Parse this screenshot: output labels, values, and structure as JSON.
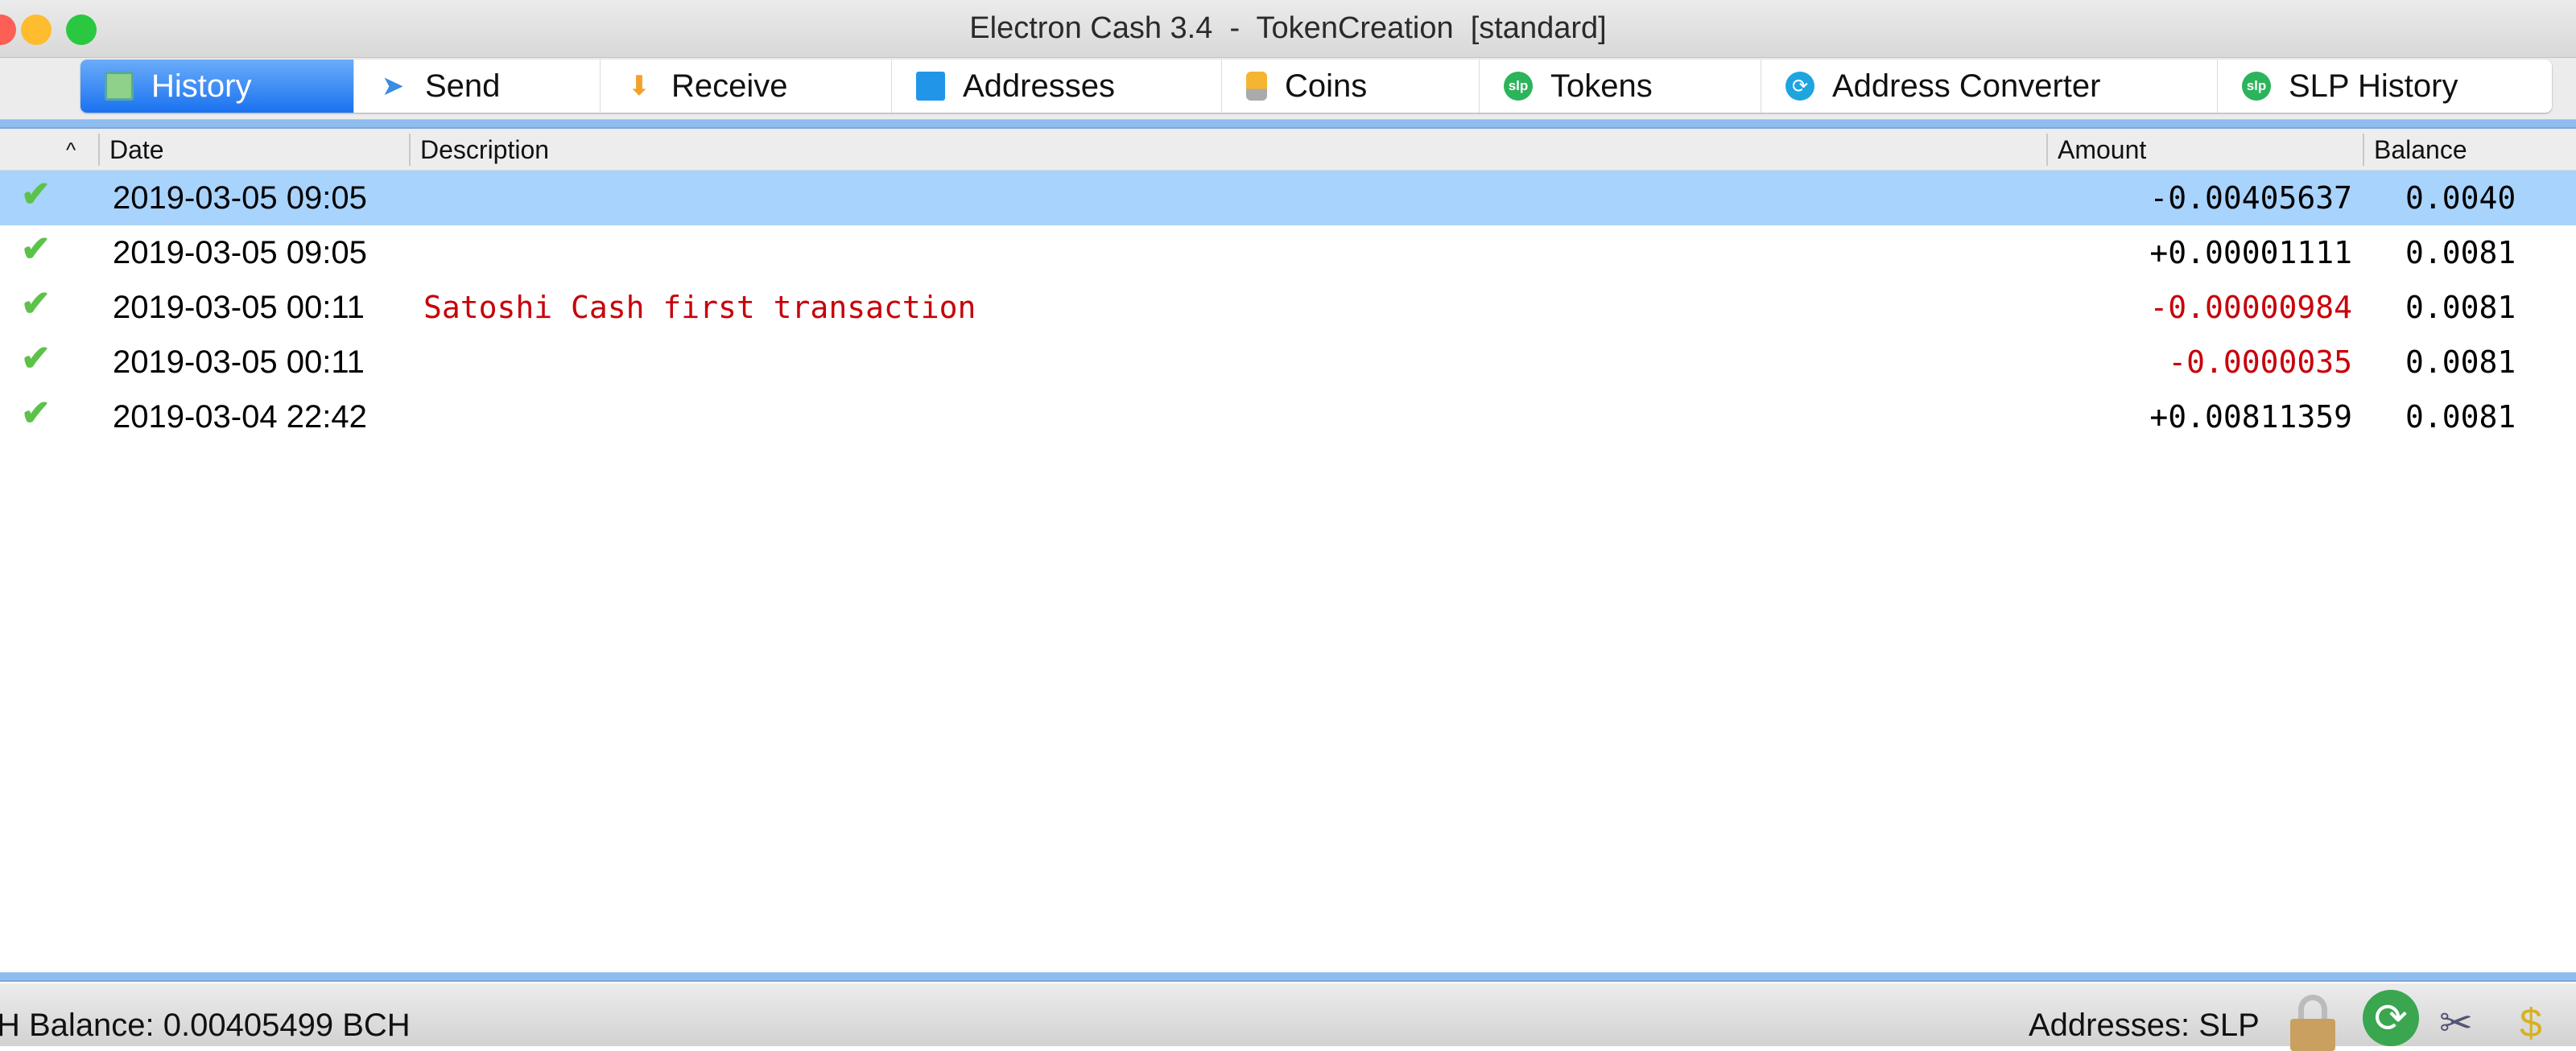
{
  "window": {
    "title": "Electron Cash 3.4  -  TokenCreation  [standard]"
  },
  "tabs": [
    {
      "label": "History",
      "icon": "history-icon",
      "active": true
    },
    {
      "label": "Send",
      "icon": "send-icon"
    },
    {
      "label": "Receive",
      "icon": "receive-icon"
    },
    {
      "label": "Addresses",
      "icon": "addresses-icon"
    },
    {
      "label": "Coins",
      "icon": "coins-icon"
    },
    {
      "label": "Tokens",
      "icon": "slp-icon",
      "icon_text": "slp"
    },
    {
      "label": "Address Converter",
      "icon": "converter-icon"
    },
    {
      "label": "SLP History",
      "icon": "slp-icon",
      "icon_text": "slp"
    }
  ],
  "table": {
    "sort_indicator": "^",
    "columns": [
      "Date",
      "Description",
      "Amount",
      "Balance"
    ],
    "rows": [
      {
        "date": "2019-03-05 09:05",
        "description": "",
        "amount": "-0.00405637",
        "balance": "0.0040",
        "selected": true
      },
      {
        "date": "2019-03-05 09:05",
        "description": "",
        "amount": "+0.00001111",
        "balance": "0.0081"
      },
      {
        "date": "2019-03-05 00:11",
        "description": "Satoshi Cash first transaction",
        "amount": "-0.00000984",
        "balance": "0.0081",
        "red": true
      },
      {
        "date": "2019-03-05 00:11",
        "description": "",
        "amount": "-0.0000035",
        "balance": "0.0081",
        "red": true
      },
      {
        "date": "2019-03-04 22:42",
        "description": "",
        "amount": "+0.00811359",
        "balance": "0.0081"
      }
    ]
  },
  "status": {
    "balance": "H Balance: 0.00405499 BCH",
    "addresses": "Addresses: SLP"
  },
  "colors": {
    "selection": "#a8d3fc",
    "negative": "#c8000a",
    "active_tab": "#1a72f0",
    "slp_green": "#2bb45a"
  }
}
